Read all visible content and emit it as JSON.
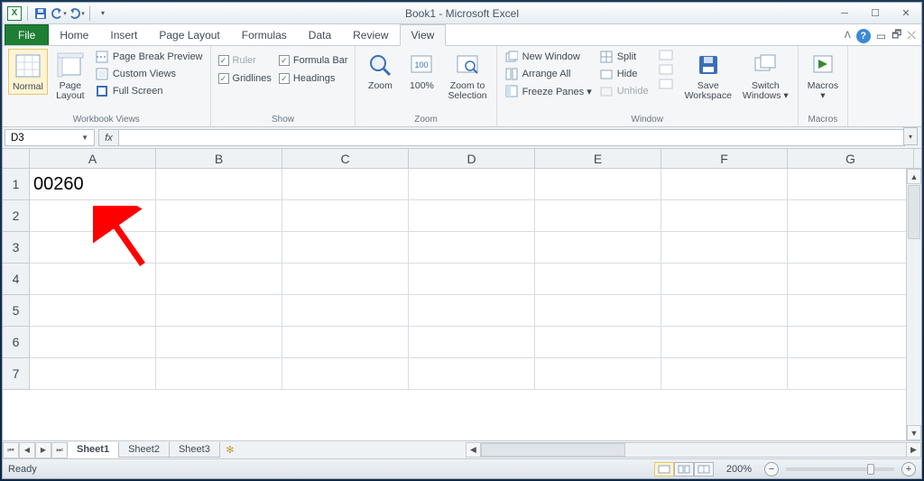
{
  "title": "Book1 - Microsoft Excel",
  "qat": {
    "app_initial": "X",
    "save": "save",
    "undo": "undo",
    "redo": "redo"
  },
  "tabs": {
    "file": "File",
    "items": [
      "Home",
      "Insert",
      "Page Layout",
      "Formulas",
      "Data",
      "Review",
      "View"
    ],
    "active": "View"
  },
  "ribbon": {
    "workbook_views": {
      "label": "Workbook Views",
      "normal": "Normal",
      "page_layout": "Page\nLayout",
      "page_break": "Page Break Preview",
      "custom": "Custom Views",
      "full": "Full Screen"
    },
    "show": {
      "label": "Show",
      "ruler": "Ruler",
      "gridlines": "Gridlines",
      "formula_bar": "Formula Bar",
      "headings": "Headings"
    },
    "zoom": {
      "label": "Zoom",
      "zoom": "Zoom",
      "hundred": "100%",
      "to_sel": "Zoom to\nSelection"
    },
    "window": {
      "label": "Window",
      "new_window": "New Window",
      "arrange": "Arrange All",
      "freeze": "Freeze Panes ▾",
      "split": "Split",
      "hide": "Hide",
      "unhide": "Unhide",
      "save_ws": "Save\nWorkspace",
      "switch": "Switch\nWindows ▾"
    },
    "macros": {
      "label": "Macros",
      "btn": "Macros\n▾"
    }
  },
  "namebox": "D3",
  "fx_label": "fx",
  "columns": [
    "A",
    "B",
    "C",
    "D",
    "E",
    "F",
    "G"
  ],
  "rows": [
    "1",
    "2",
    "3",
    "4",
    "5",
    "6",
    "7"
  ],
  "cells": {
    "A1": "00260"
  },
  "sheets": {
    "items": [
      "Sheet1",
      "Sheet2",
      "Sheet3"
    ],
    "active": "Sheet1"
  },
  "status": {
    "ready": "Ready",
    "zoom": "200%"
  }
}
